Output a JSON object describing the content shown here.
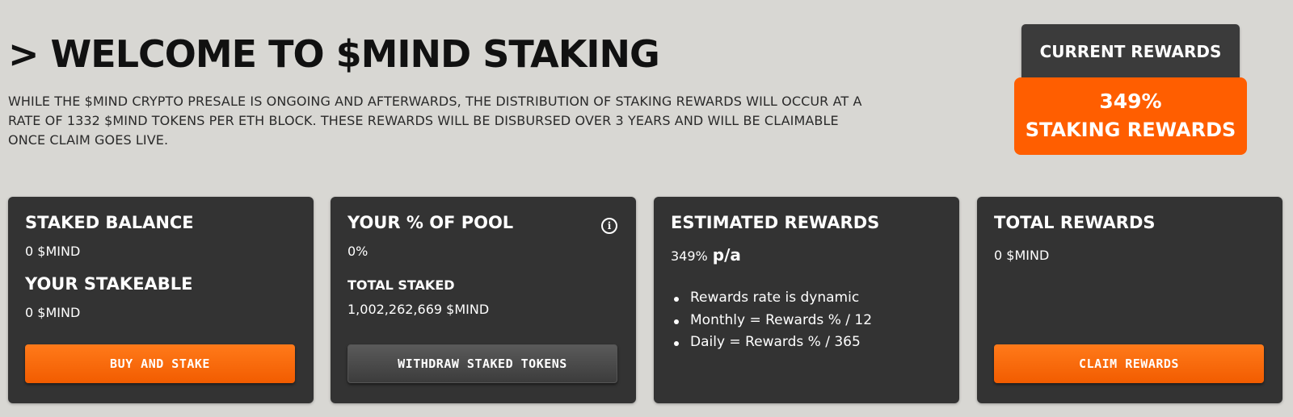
{
  "hero": {
    "title": "> WELCOME TO $MIND STAKING",
    "description": "WHILE THE $MIND CRYPTO PRESALE IS ONGOING AND AFTERWARDS, THE DISTRIBUTION OF STAKING REWARDS WILL OCCUR AT A RATE OF 1332 $MIND TOKENS PER ETH BLOCK. THESE REWARDS WILL BE DISBURSED OVER 3 YEARS AND WILL BE CLAIMABLE ONCE CLAIM GOES LIVE."
  },
  "current_rewards": {
    "header": "CURRENT REWARDS",
    "percent": "349%",
    "label": "STAKING REWARDS"
  },
  "cards": {
    "staked_balance": {
      "title": "STAKED BALANCE",
      "value": "0  $MIND",
      "stakeable_title": "YOUR STAKEABLE",
      "stakeable_value": "0  $MIND",
      "button": "BUY AND STAKE"
    },
    "pool": {
      "title": "YOUR % OF POOL",
      "info_icon": "info-icon",
      "value": "0%",
      "total_staked_title": "TOTAL STAKED",
      "total_staked_value": "1,002,262,669  $MIND",
      "button": "WITHDRAW STAKED TOKENS"
    },
    "estimated": {
      "title": "ESTIMATED REWARDS",
      "rate_percent": "349%",
      "rate_unit": "p/a",
      "bullets": [
        "Rewards rate is dynamic",
        "Monthly = Rewards % / 12",
        "Daily = Rewards % / 365"
      ]
    },
    "total": {
      "title": "TOTAL REWARDS",
      "value": "0  $MIND",
      "button": "CLAIM REWARDS"
    }
  },
  "colors": {
    "background": "#d8d7d3",
    "card": "#333333",
    "accent": "#ff5e00",
    "dark_button": "#3c3c3c"
  }
}
